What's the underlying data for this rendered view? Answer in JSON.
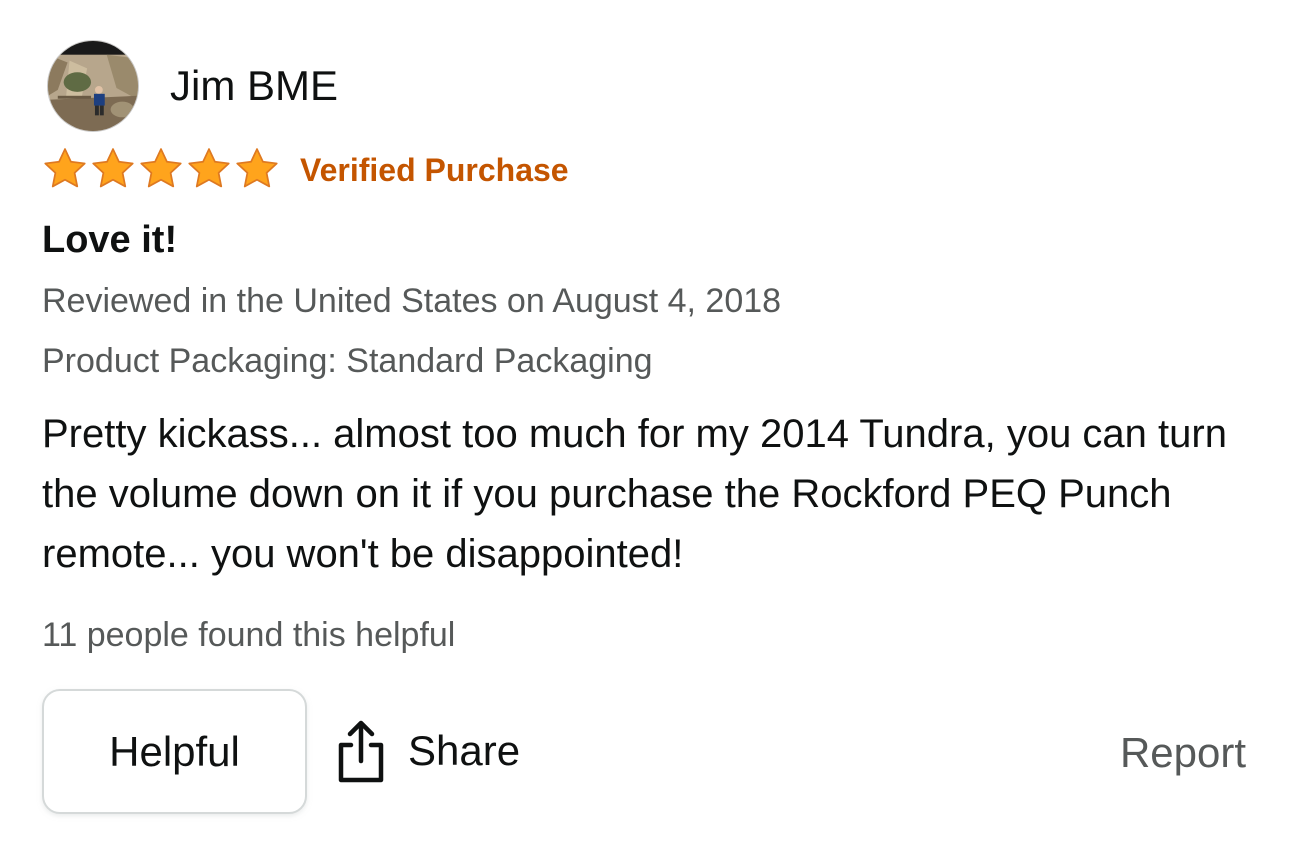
{
  "reviewer": {
    "name": "Jim BME",
    "avatar_icon": "user-avatar-photo"
  },
  "rating": {
    "stars": 5,
    "max": 5,
    "star_color": "#ffa41c",
    "verified_label": "Verified Purchase",
    "verified_color": "#c45500"
  },
  "review": {
    "title": "Love it!",
    "date_line": "Reviewed in the United States on August 4, 2018",
    "variant_line": "Product Packaging: Standard Packaging",
    "body": "Pretty kickass... almost too much for my 2014 Tundra, you can turn the volume down on it if you purchase the Rockford PEQ Punch remote... you won't be disappointed!",
    "helpful_count_text": "11 people found this helpful"
  },
  "actions": {
    "helpful_label": "Helpful",
    "share_label": "Share",
    "share_icon": "share-icon",
    "report_label": "Report"
  }
}
